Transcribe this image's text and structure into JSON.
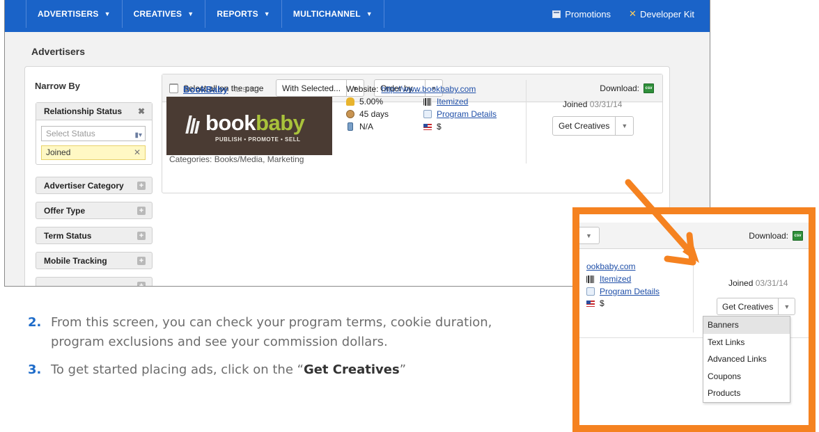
{
  "nav": {
    "items": [
      {
        "label": "ADVERTISERS"
      },
      {
        "label": "CREATIVES"
      },
      {
        "label": "REPORTS"
      },
      {
        "label": "MULTICHANNEL"
      }
    ],
    "promotions": "Promotions",
    "developer_kit": "Developer Kit"
  },
  "page_title": "Advertisers",
  "narrow_by": {
    "title": "Narrow By",
    "relationship": {
      "label": "Relationship Status",
      "placeholder": "Select Status",
      "selected": "Joined"
    },
    "filters": [
      "Advertiser Category",
      "Offer Type",
      "Term Status",
      "Mobile Tracking"
    ]
  },
  "toolbar": {
    "select_all": "Select all on the page",
    "with_selected": "With Selected...",
    "order_by": "Order by...",
    "download": "Download:",
    "csv_icon_text": "csv"
  },
  "advertiser": {
    "name": "BookBaby",
    "id": "ID:5967",
    "logo": {
      "word1": "book",
      "word2": "baby",
      "tagline": "PUBLISH • PROMOTE • SELL"
    },
    "categories": "Categories: Books/Media, Marketing",
    "website_label": "Website:",
    "website_url": "http://www.bookbaby.com",
    "commission": "5.00%",
    "cookie_duration": "45 days",
    "mobile": "N/A",
    "itemized": "Itemized",
    "program_details": "Program Details",
    "currency": "$",
    "joined_label": "Joined",
    "joined_date": "03/31/14",
    "get_creatives": "Get Creatives"
  },
  "instructions": [
    {
      "num": "2.",
      "text": "From this screen, you can check your program terms, cookie duration, program exclusions and see your commission dollars."
    },
    {
      "num": "3.",
      "pre": "To get started placing ads, click on the “",
      "bold": "Get Creatives",
      "post": "”"
    }
  ],
  "zoom": {
    "download": "Download:",
    "website_fragment": "ookbaby.com",
    "itemized": "Itemized",
    "program_details": "Program Details",
    "currency": "$",
    "joined_label": "Joined",
    "joined_date": "03/31/14",
    "get_creatives": "Get Creatives",
    "menu": [
      "Banners",
      "Text Links",
      "Advanced Links",
      "Coupons",
      "Products"
    ],
    "menu_active": "Banners"
  },
  "colors": {
    "nav_blue": "#1a63c8",
    "link_blue": "#1f4fa8",
    "highlight_orange": "#f58220",
    "tag_yellow": "#fff8c4",
    "logo_brown": "#4a3b33",
    "logo_green": "#a9c23b"
  }
}
